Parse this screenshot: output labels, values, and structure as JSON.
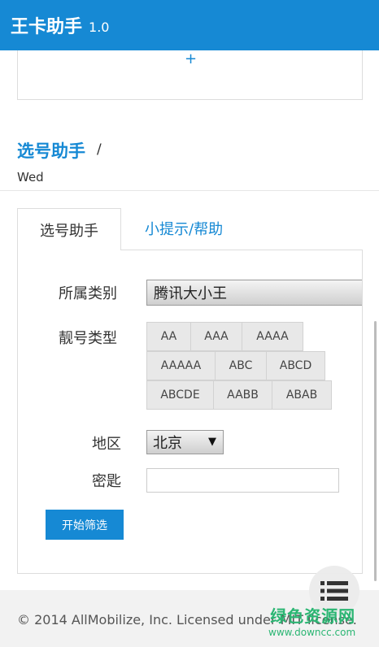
{
  "app_bar": {
    "title": "王卡助手",
    "version": "1.0"
  },
  "top_card": {
    "add_symbol": "+"
  },
  "section": {
    "title": "选号助手",
    "slash": "/",
    "weekday": "Wed"
  },
  "tabs": [
    {
      "label": "选号助手",
      "active": true
    },
    {
      "label": "小提示/帮助",
      "active": false
    }
  ],
  "form": {
    "category_label": "所属类别",
    "category_value": "腾讯大小王",
    "pattern_label": "靓号类型",
    "patterns": [
      "AA",
      "AAA",
      "AAAA",
      "AAAAA",
      "ABC",
      "ABCD",
      "ABCDE",
      "AABB",
      "ABAB"
    ],
    "region_label": "地区",
    "region_value": "北京",
    "keyword_label": "密匙",
    "keyword_value": "",
    "submit_label": "开始筛选"
  },
  "footer": {
    "text": "© 2014 AllMobilize, Inc. Licensed under MIT license."
  },
  "watermark": {
    "main": "绿色资源网",
    "url": "www.downcc.com"
  },
  "icons": {
    "add": "plus-icon",
    "menu": "menu-icon",
    "dropdown": "caret-down-icon"
  },
  "colors": {
    "primary": "#1689d4",
    "watermark": "#2bb673"
  }
}
